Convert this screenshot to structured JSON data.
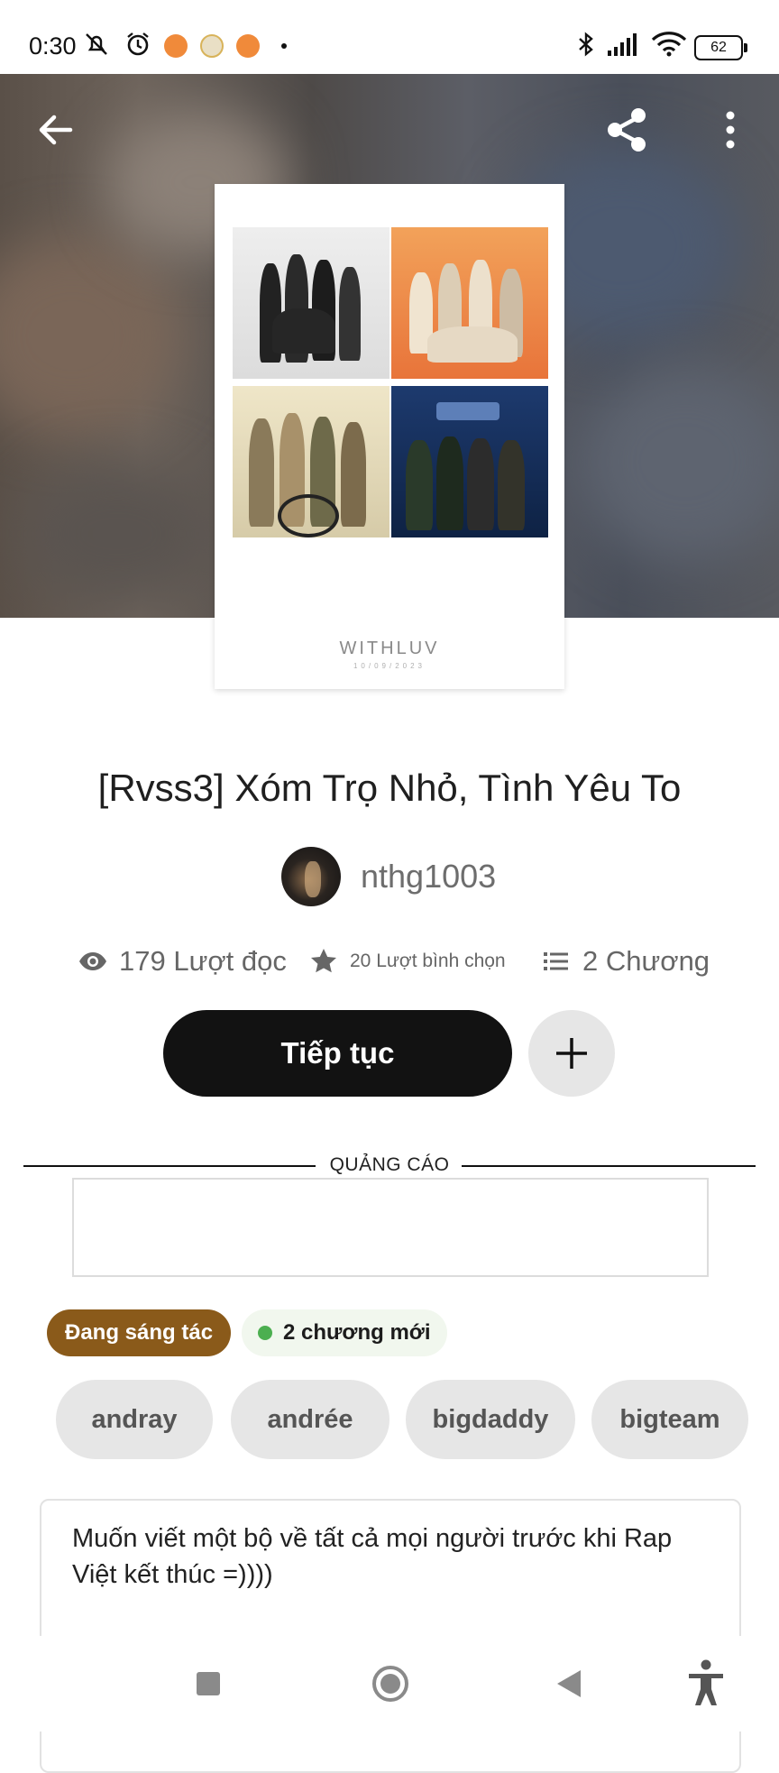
{
  "status_bar": {
    "time": "0:30",
    "battery": "62",
    "icons": [
      "mute-icon",
      "alarm-icon",
      "notification-app-icon",
      "notification-app-icon",
      "notification-app-icon",
      "more-dot-icon",
      "bluetooth-icon",
      "signal-icon",
      "wifi-icon",
      "battery-icon"
    ]
  },
  "toolbar": {
    "back_icon": "arrow-left-icon",
    "share_icon": "share-icon",
    "more_icon": "more-vertical-icon"
  },
  "cover": {
    "caption": "WITHLUV",
    "subcaption": "10/09/2023"
  },
  "story": {
    "title": "[Rvss3] Xóm Trọ Nhỏ, Tình Yêu To",
    "author": "nthg1003"
  },
  "stats": {
    "reads": "179 Lượt đọc",
    "votes": "20 Lượt bình chọn",
    "chapters": "2 Chương"
  },
  "actions": {
    "continue_label": "Tiếp tục",
    "add_icon": "plus-icon"
  },
  "ad": {
    "label": "QUẢNG CÁO"
  },
  "badges": {
    "status": "Đang sáng tác",
    "new_chapters": "2 chương mới"
  },
  "tags": [
    "andray",
    "andrée",
    "bigdaddy",
    "bigteam"
  ],
  "description": "Muốn viết một bộ về tất cả mọi người trước khi Rap Việt kết thúc =))))\n\nTextfic again",
  "navbar": [
    "square-icon",
    "home-circle-icon",
    "back-triangle-icon",
    "accessibility-icon"
  ],
  "colors": {
    "status_badge": "#8a5a1a",
    "new_dot": "#4caf50",
    "continue_button": "#121212"
  }
}
